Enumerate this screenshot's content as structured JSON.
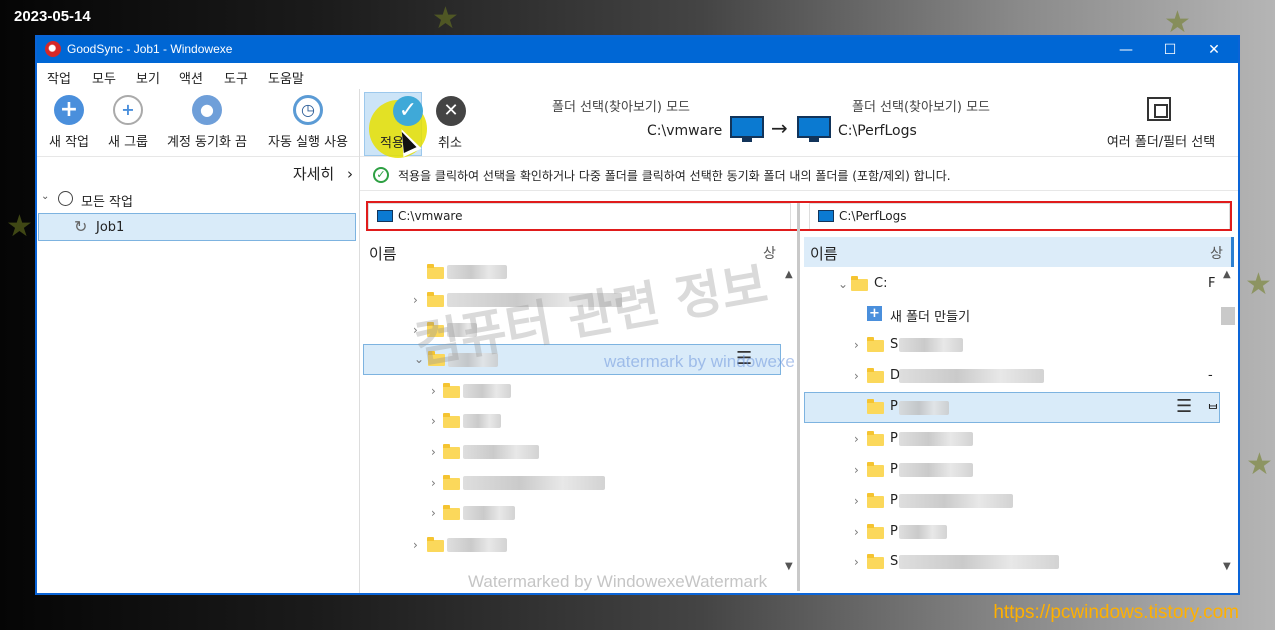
{
  "overlay": {
    "date": "2023-05-14",
    "site_url": "https://pcwindows.tistory.com",
    "watermark_big": "컴퓨터 관련 정보",
    "watermark_center": "watermark by windowexe",
    "watermark_bottom": "Watermarked by WindowexeWatermark"
  },
  "window": {
    "title": "GoodSync - Job1    - Windowexe",
    "controls": {
      "minimize": "—",
      "maximize": "☐",
      "close": "✕"
    }
  },
  "menu": [
    "작업",
    "모두",
    "보기",
    "액션",
    "도구",
    "도움말"
  ],
  "toolbar": {
    "new_job": "새 작업",
    "new_group": "새 그룹",
    "account_sync_off": "계정 동기화 끔",
    "auto_run": "자동 실행 사용",
    "apply": "적용",
    "cancel": "취소",
    "multi_folder_filter": "여러 폴더/필터 선택"
  },
  "sync_header": {
    "left_mode": "폴더 선택(찾아보기) 모드",
    "right_mode": "폴더 선택(찾아보기) 모드",
    "left_path": "C:\\vmware",
    "right_path": "C:\\PerfLogs",
    "arrow": "→"
  },
  "info_message": "적용을 클릭하여 선택을 확인하거나 다중 폴더를 클릭하여 선택한 동기화 폴더 내의 폴더를 (포함/제외) 합니다.",
  "sidebar": {
    "details": "자세히",
    "details_chevron": "›",
    "all_jobs": "모든 작업",
    "job": "Job1"
  },
  "left_pane": {
    "path": "C:\\vmware",
    "column_name": "이름",
    "column_second": "상"
  },
  "right_pane": {
    "path": "C:\\PerfLogs",
    "column_name": "이름",
    "column_second": "상",
    "drive": "C:",
    "drive_col": "F",
    "new_folder": "새 폴더 만들기",
    "row_letters": [
      "S",
      "D",
      "P",
      "P",
      "P",
      "P",
      "P",
      "S"
    ],
    "row_right_marks": [
      "-",
      "ᄇ"
    ]
  },
  "colors": {
    "titlebar": "#0067d5",
    "selection": "#d9ebf9",
    "red_frame": "#e01b1b",
    "accent_url": "#ffb000"
  }
}
